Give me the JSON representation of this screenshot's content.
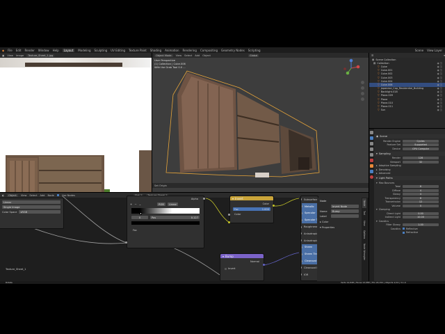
{
  "menubar": {
    "items": [
      "File",
      "Edit",
      "Render",
      "Window",
      "Help"
    ],
    "workspaces": [
      "Layout",
      "Modeling",
      "Sculpting",
      "UV Editing",
      "Texture Paint",
      "Shading",
      "Animation",
      "Rendering",
      "Compositing",
      "Geometry Nodes",
      "Scripting"
    ],
    "active_workspace": "Layout",
    "scene": "Scene",
    "view_layer": "View Layer"
  },
  "image_editor": {
    "header": [
      "View",
      "Image"
    ],
    "image_name": "Texture_Sheet_1.jpg"
  },
  "viewport": {
    "header": [
      "Object Mode",
      "View",
      "Select",
      "Add",
      "Object"
    ],
    "transform": "Global",
    "overlay_lines": [
      "User Perspective",
      "(1) Collection | Cube.006",
      "With the Grab Tool 0.0 ..."
    ],
    "footer_label": "Set Origin"
  },
  "outliner": {
    "header": "Scene Collection",
    "items": [
      {
        "name": "Collection",
        "indent": 0
      },
      {
        "name": "Cube",
        "indent": 1
      },
      {
        "name": "Cube.001",
        "indent": 1
      },
      {
        "name": "Cube.002",
        "indent": 1
      },
      {
        "name": "Cube.003",
        "indent": 1
      },
      {
        "name": "Cube.004",
        "indent": 1
      },
      {
        "name": "Cube.006",
        "indent": 1
      },
      {
        "name": "japanese_Cap_Residential_Building",
        "indent": 1
      },
      {
        "name": "Backlight.018",
        "indent": 1
      },
      {
        "name": "Plane.009",
        "indent": 1
      },
      {
        "name": "Plane",
        "indent": 1
      },
      {
        "name": "Plane.010",
        "indent": 1
      },
      {
        "name": "Plane.011",
        "indent": 1
      },
      {
        "name": "Sun",
        "indent": 1
      }
    ]
  },
  "properties": {
    "scene_label": "Scene",
    "render_rows": [
      {
        "label": "Render Engine",
        "value": "Cycles"
      },
      {
        "label": "Feature Set",
        "value": "Supported"
      },
      {
        "label": "Device",
        "value": "GPU Compute"
      }
    ],
    "sampling_title": "Sampling",
    "sampling_rows": [
      {
        "label": "Render",
        "value": "128"
      },
      {
        "label": "Viewport",
        "value": "32"
      }
    ],
    "adaptive_label": "Adaptive Sampling",
    "denoising_label": "Denoising",
    "advanced_label": "Advanced",
    "light_paths_title": "Light Paths",
    "max_bounces_title": "Max Bounces",
    "bounce_rows": [
      {
        "label": "Total",
        "value": "8"
      },
      {
        "label": "Diffuse",
        "value": "4"
      },
      {
        "label": "Glossy",
        "value": "4"
      },
      {
        "label": "Transparency",
        "value": "8"
      },
      {
        "label": "Transmission",
        "value": "12"
      },
      {
        "label": "Volume",
        "value": "0"
      }
    ],
    "clamping_title": "Clamping",
    "clamp_rows": [
      {
        "label": "Direct Light",
        "value": "0.00"
      },
      {
        "label": "Indirect Light",
        "value": "10.00"
      }
    ],
    "caustics_title": "Caustics",
    "filter_row": {
      "label": "Filter Glossy",
      "value": "1.00"
    },
    "caustics_checks": [
      "Reflective",
      "Refractive"
    ]
  },
  "node_editor": {
    "header": [
      "Object",
      "View",
      "Select",
      "Add",
      "Node"
    ],
    "use_nodes": "Use Nodes",
    "slot": "Slot 1",
    "material": "Texture Sheet 1",
    "left_node": {
      "rows": [
        "Linear",
        "Single Image"
      ],
      "colorspace_label": "Color Space",
      "colorspace_value": "sRGB"
    },
    "image_label": "Texture_Sheet_1",
    "ramp": {
      "mode": "RGB",
      "interp": "Linear",
      "index": "0",
      "pos_label": "Pos",
      "pos_value": "0.127",
      "fac": "Fac",
      "alpha": "Alpha"
    },
    "invert": {
      "title": "Invert",
      "out": "Color",
      "fac_label": "Fac",
      "fac_value": "1.000",
      "in": "Color"
    },
    "bump": {
      "title": "Bump",
      "out": "Normal",
      "invert": "Invert"
    },
    "bsdf_sockets": [
      "Subsurface",
      "Metallic",
      "Specular",
      "Specular Tint",
      "Roughness",
      "Anisotropic",
      "Anisotropic Rotation",
      "Sheen",
      "Sheen Tint",
      "Clearcoat",
      "Clearcoat Roughness",
      "IOR"
    ],
    "sidebar": {
      "title": "Node",
      "name_label": "Name",
      "name_value": "Bump",
      "label_label": "Label",
      "node_value": "Invert Node",
      "color_label": "Color",
      "properties_label": "Properties"
    },
    "sidebar_tabs": [
      "Node",
      "Tool",
      "View",
      "Options",
      "Node Wrangler"
    ]
  },
  "status": {
    "left": "Rotate",
    "right": "Verts 12,648 | Faces 12,080 | Tris 24,152 | Objects 1/14 | 3.1.0"
  },
  "colors": {
    "accent": "#e8893a",
    "node_invert": "#c9a43a",
    "node_bump": "#7b63c8",
    "socket_yellow": "#c7c729",
    "socket_gray": "#a0a0a0",
    "socket_purple": "#6363c7"
  }
}
